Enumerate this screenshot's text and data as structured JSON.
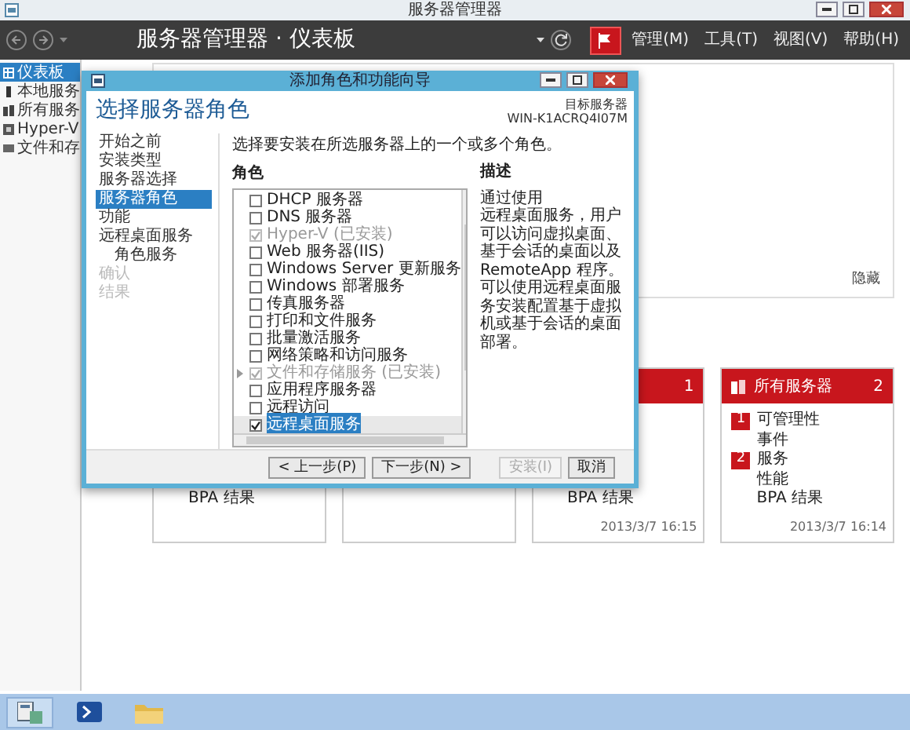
{
  "window": {
    "title": "服务器管理器"
  },
  "header": {
    "title": "服务器管理器",
    "separator": "·",
    "page": "仪表板",
    "menus": [
      "管理(M)",
      "工具(T)",
      "视图(V)",
      "帮助(H)"
    ]
  },
  "sidebar": {
    "items": [
      {
        "label": "仪表板",
        "selected": true
      },
      {
        "label": "本地服务",
        "selected": false
      },
      {
        "label": "所有服务",
        "selected": false
      },
      {
        "label": "Hyper-V",
        "selected": false
      },
      {
        "label": "文件和存",
        "selected": false
      }
    ]
  },
  "welcome": {
    "hide_link": "隐藏"
  },
  "tiles": [
    {
      "kind": "group",
      "rows": [
        {
          "label": "BPA 结果"
        }
      ]
    },
    {
      "kind": "group"
    },
    {
      "kind": "group",
      "count": "1",
      "rows": [
        {
          "label": "BPA 结果"
        }
      ],
      "date": "2013/3/7 16:15"
    },
    {
      "kind": "group",
      "title": "所有服务器",
      "count": "2",
      "rows": [
        {
          "label": "可管理性",
          "badge": "1"
        },
        {
          "label": "事件"
        },
        {
          "label": "服务",
          "badge": "2"
        },
        {
          "label": "性能"
        },
        {
          "label": "BPA 结果"
        }
      ],
      "date": "2013/3/7 16:14"
    }
  ],
  "dialog": {
    "title": "添加角色和功能向导",
    "heading": "选择服务器角色",
    "target_label": "目标服务器",
    "target_server": "WIN-K1ACRQ4I07M",
    "steps": [
      {
        "label": "开始之前",
        "selected": false,
        "disabled": false,
        "sub": false
      },
      {
        "label": "安装类型",
        "selected": false,
        "disabled": false,
        "sub": false
      },
      {
        "label": "服务器选择",
        "selected": false,
        "disabled": false,
        "sub": false
      },
      {
        "label": "服务器角色",
        "selected": true,
        "disabled": false,
        "sub": false
      },
      {
        "label": "功能",
        "selected": false,
        "disabled": false,
        "sub": false
      },
      {
        "label": "远程桌面服务",
        "selected": false,
        "disabled": false,
        "sub": false
      },
      {
        "label": "角色服务",
        "selected": false,
        "disabled": false,
        "sub": true
      },
      {
        "label": "确认",
        "selected": false,
        "disabled": true,
        "sub": false
      },
      {
        "label": "结果",
        "selected": false,
        "disabled": true,
        "sub": false
      }
    ],
    "instruction": "选择要安装在所选服务器上的一个或多个角色。",
    "roles_heading": "角色",
    "roles": [
      {
        "label": "DHCP 服务器",
        "checked": false,
        "disabled": false,
        "selected": false,
        "expandable": false
      },
      {
        "label": "DNS 服务器",
        "checked": false,
        "disabled": false,
        "selected": false,
        "expandable": false
      },
      {
        "label": "Hyper-V (已安装)",
        "checked": true,
        "disabled": true,
        "selected": false,
        "expandable": false
      },
      {
        "label": "Web 服务器(IIS)",
        "checked": false,
        "disabled": false,
        "selected": false,
        "expandable": false
      },
      {
        "label": "Windows Server 更新服务",
        "checked": false,
        "disabled": false,
        "selected": false,
        "expandable": false
      },
      {
        "label": "Windows 部署服务",
        "checked": false,
        "disabled": false,
        "selected": false,
        "expandable": false
      },
      {
        "label": "传真服务器",
        "checked": false,
        "disabled": false,
        "selected": false,
        "expandable": false
      },
      {
        "label": "打印和文件服务",
        "checked": false,
        "disabled": false,
        "selected": false,
        "expandable": false
      },
      {
        "label": "批量激活服务",
        "checked": false,
        "disabled": false,
        "selected": false,
        "expandable": false
      },
      {
        "label": "网络策略和访问服务",
        "checked": false,
        "disabled": false,
        "selected": false,
        "expandable": false
      },
      {
        "label": "文件和存储服务 (已安装)",
        "checked": true,
        "disabled": true,
        "selected": false,
        "expandable": true
      },
      {
        "label": "应用程序服务器",
        "checked": false,
        "disabled": false,
        "selected": false,
        "expandable": false
      },
      {
        "label": "远程访问",
        "checked": false,
        "disabled": false,
        "selected": false,
        "expandable": false
      },
      {
        "label": "远程桌面服务",
        "checked": true,
        "disabled": false,
        "selected": true,
        "expandable": false
      }
    ],
    "description_heading": "描述",
    "description": [
      "通过使用",
      "远程桌面服务",
      "，用户可以访问虚拟桌面、基于会话的桌面以及 RemoteApp 程序。可以使用远程桌面服务安装配置基于虚拟机或基于会话的桌面部署。"
    ],
    "buttons": [
      {
        "label": "< 上一步(P)",
        "disabled": false
      },
      {
        "label": "下一步(N) >",
        "disabled": false
      },
      {
        "label": "安装(I)",
        "disabled": true
      },
      {
        "label": "取消",
        "disabled": false
      }
    ]
  }
}
